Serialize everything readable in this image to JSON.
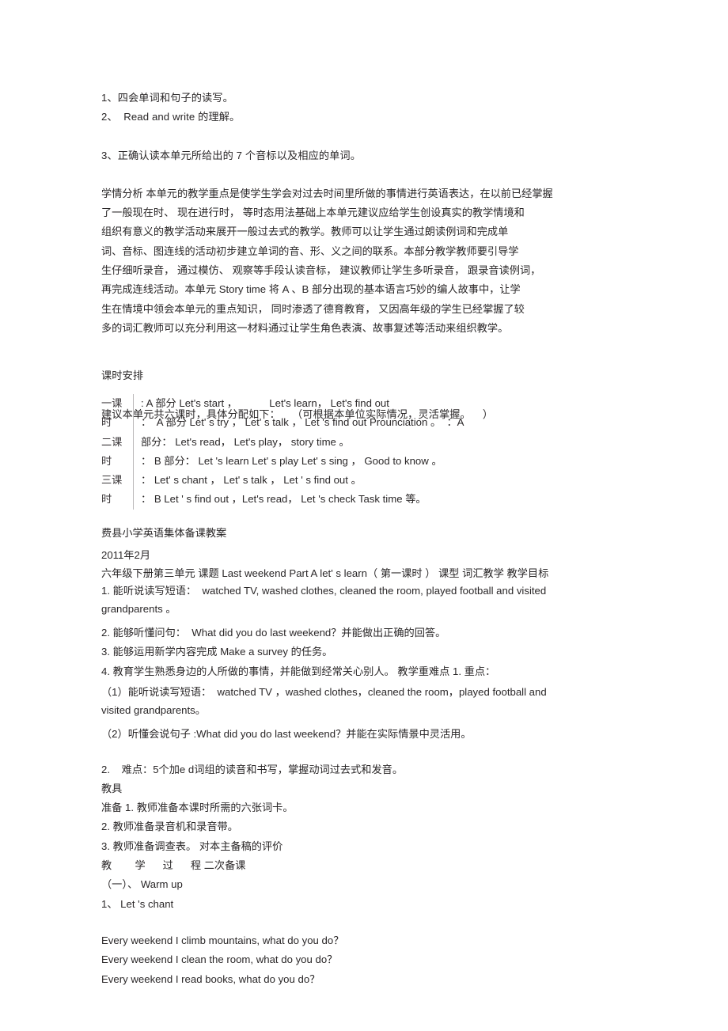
{
  "document": {
    "title": "费县小学英语集体备课教案",
    "date": "2011年2月",
    "background_color": "#ffffff",
    "text_color": "#2a2728",
    "divider_color": "#b9b7b8"
  },
  "objectives_top": {
    "item1": "1、四会单词和句子的读写。",
    "item2": "2、  Read and write 的理解。",
    "item3": "3、正确认读本单元所给出的 7 个音标以及相应的单词。"
  },
  "analysis": {
    "line1": "学情分析 本单元的教学重点是使学生学会对过去时间里所做的事情进行英语表达，在以前已经掌握",
    "line2": "了一般现在时、 现在进行时， 等时态用法基础上本单元建议应给学生创设真实的教学情境和",
    "line3": "组织有意义的教学活动来展开一般过去式的教学。教师可以让学生通过朗读例词和完成单",
    "line4": "词、音标、图连线的活动初步建立单词的音、形、义之间的联系。本部分教学教师要引导学",
    "line5": "生仔细听录音， 通过模仿、 观察等手段认读音标， 建议教师让学生多听录音， 跟录音读例词，",
    "line6": "再完成连线活动。本单元 Story time 将 A 、B 部分出现的基本语言巧妙的编人故事中，让学",
    "line7": "生在情境中领会本单元的重点知识， 同时渗透了德育教育， 又因高年级的学生已经掌握了较",
    "line8": "多的词汇教师可以充分利用这一材料通过让学生角色表演、故事复述等活动来组织教学。"
  },
  "schedule": {
    "heading": "课时安排",
    "intro": "建议本单元共六课时，具体分配如下：    （可根据本单位实际情况，灵活掌握。    ）",
    "rows": [
      {
        "label": "一课",
        "text": ": A 部分 Let's start ，           Let's learn， Let's find out"
      },
      {
        "label": "时",
        "text": "：  A 部分 Let' s try ， Let' s talk ， Let 's find out Prounciation 。  ：A"
      },
      {
        "label": "二课",
        "text": "部分： Let's read， Let's play， story time 。"
      },
      {
        "label": "时",
        "text": "： B 部分： Let 's learn Let' s play Let' s sing ， Good to know 。"
      },
      {
        "label": "三课",
        "text": "： Let' s chant ， Let' s talk ， Let ' s find out 。"
      },
      {
        "label": "时",
        "text": "： B Let ' s find out ，Let's read， Let 's check Task time 等。"
      }
    ]
  },
  "lesson_plan": {
    "header_title": "费县小学英语集体备课教案",
    "header_date": "2011年2月",
    "meta_line": "六年级下册第三单元 课题 Last weekend Part A let' s learn（ 第一课时 ） 课型 词汇教学 教学目标",
    "goal1_a": "1. 能听说读写短语：  watched TV, washed clothes, cleaned the room, played football and visited",
    "goal1_b": "grandparents 。",
    "goal2": "2. 能够听懂问句：  What did you do last weekend？并能做出正确的回答。",
    "goal3": "3. 能够运用新学内容完成 Make a survey 的任务。",
    "goal4": "4. 教育学生熟悉身边的人所做的事情，并能做到经常关心别人。 教学重难点 1. 重点：",
    "key1_a": "（1）能听说读写短语：  watched TV ，washed clothes，cleaned the room，played football and",
    "key1_b": "visited grandparents。",
    "key2": "（2）听懂会说句子 :What did you do last weekend？并能在实际情景中灵活用。",
    "difficulty": "2.    难点：5个加e d词组的读音和书写，掌握动词过去式和发音。",
    "teaching_aids_heading": "教具",
    "aid1": "准备 1. 教师准备本课时所需的六张词卡。",
    "aid2": "2. 教师准备录音机和录音带。",
    "aid3": "3. 教师准备调查表。 对本主备稿的评价",
    "process_header": "教        学      过      程 二次备课",
    "section1": "（一）、 Warm up",
    "step1": "1、 Let 's chant",
    "chant_line1": "Every weekend I climb mountains, what do you do？",
    "chant_line2": "Every weekend I clean the room, what do you do？",
    "chant_line3": "Every weekend I read books, what do you do？"
  }
}
